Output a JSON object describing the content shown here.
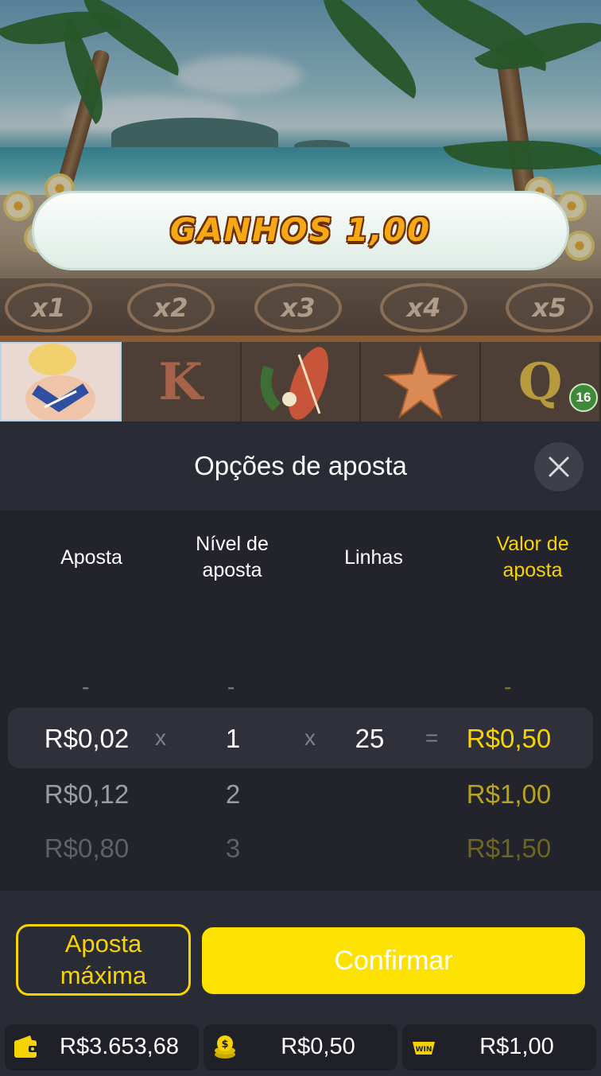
{
  "game": {
    "banner_text": "GANHOS 1,00",
    "multipliers": [
      "x1",
      "x2",
      "x3",
      "x4",
      "x5"
    ],
    "reel_symbols": [
      "surfer-girl",
      "K",
      "surfboard",
      "starfish",
      "Q"
    ],
    "symbol_badge": "16"
  },
  "panel": {
    "title": "Opções de aposta",
    "columns": {
      "bet": "Aposta",
      "level": "Nível de aposta",
      "lines": "Linhas",
      "value": "Valor de aposta"
    },
    "placeholder": "-",
    "selected": {
      "bet": "R$0,02",
      "times1": "x",
      "level": "1",
      "times2": "x",
      "lines": "25",
      "equals": "=",
      "value": "R$0,50"
    },
    "rows_below": [
      {
        "bet": "R$0,12",
        "level": "2",
        "value": "R$1,00"
      },
      {
        "bet": "R$0,80",
        "level": "3",
        "value": "R$1,50"
      }
    ],
    "max_bet_label_line1": "Aposta",
    "max_bet_label_line2": "máxima",
    "confirm_label": "Confirmar"
  },
  "footer": {
    "balance": "R$3.653,68",
    "bet": "R$0,50",
    "win": "R$1,00",
    "win_icon_text": "WIN"
  },
  "colors": {
    "accent": "#f7d300",
    "panel_bg": "#2a2c35",
    "picker_bg": "#22232b"
  }
}
